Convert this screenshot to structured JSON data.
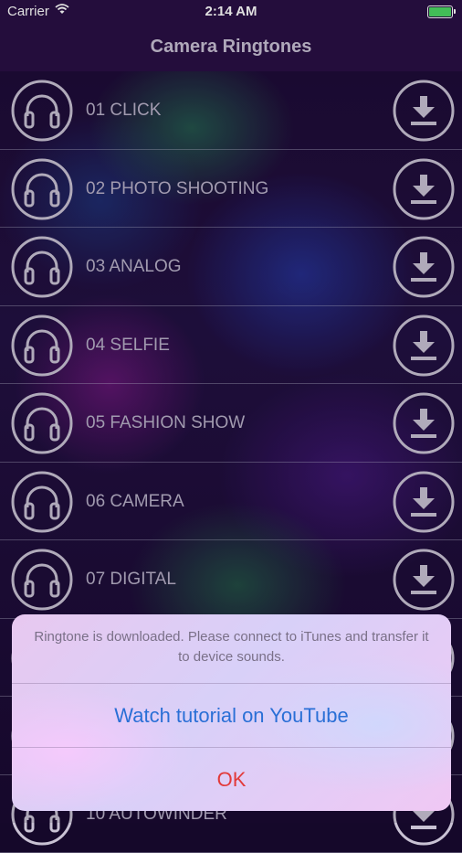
{
  "status_bar": {
    "carrier": "Carrier",
    "time": "2:14 AM",
    "battery_color": "#4cd964"
  },
  "nav": {
    "title": "Camera Ringtones"
  },
  "ringtones": [
    {
      "label": "01 CLICK",
      "icon": "headphones-icon",
      "action_icon": "download-icon"
    },
    {
      "label": "02 PHOTO SHOOTING",
      "icon": "headphones-icon",
      "action_icon": "download-icon"
    },
    {
      "label": "03 ANALOG",
      "icon": "headphones-icon",
      "action_icon": "download-icon"
    },
    {
      "label": "04 SELFIE",
      "icon": "headphones-icon",
      "action_icon": "download-icon"
    },
    {
      "label": "05 FASHION SHOW",
      "icon": "headphones-icon",
      "action_icon": "download-icon"
    },
    {
      "label": "06 CAMERA",
      "icon": "headphones-icon",
      "action_icon": "download-icon"
    },
    {
      "label": "07 DIGITAL",
      "icon": "headphones-icon",
      "action_icon": "download-icon"
    },
    {
      "label": "",
      "icon": "headphones-icon",
      "action_icon": "download-icon"
    },
    {
      "label": "",
      "icon": "headphones-icon",
      "action_icon": "download-icon"
    },
    {
      "label": "10 AUTOWINDER",
      "icon": "headphones-icon",
      "action_icon": "download-icon"
    }
  ],
  "alert": {
    "message": "Ringtone is downloaded. Please connect to iTunes and transfer it to device sounds.",
    "youtube_button": "Watch tutorial on YouTube",
    "ok_button": "OK"
  },
  "colors": {
    "primary_button": "#2a6fd6",
    "destructive_button": "#e23a3a"
  }
}
